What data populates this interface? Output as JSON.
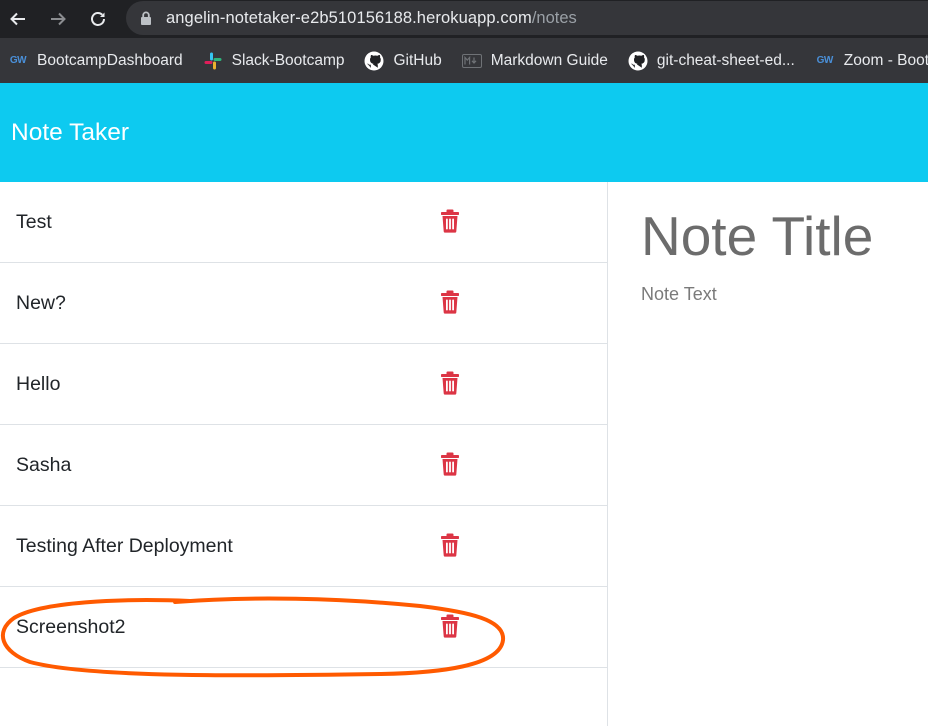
{
  "browser": {
    "url_host": "angelin-notetaker-e2b510156188.herokuapp.com",
    "url_path": "/notes",
    "bookmarks": [
      {
        "label": "BootcampDashboard",
        "icon": "gw-icon"
      },
      {
        "label": "Slack-Bootcamp",
        "icon": "slack-icon"
      },
      {
        "label": "GitHub",
        "icon": "github-icon"
      },
      {
        "label": "Markdown Guide",
        "icon": "markdown-icon"
      },
      {
        "label": "git-cheat-sheet-ed...",
        "icon": "github-icon"
      },
      {
        "label": "Zoom - Bootca",
        "icon": "gw-icon"
      }
    ]
  },
  "app": {
    "title": "Note Taker"
  },
  "notes": [
    {
      "title": "Test"
    },
    {
      "title": "New?"
    },
    {
      "title": "Hello"
    },
    {
      "title": "Sasha"
    },
    {
      "title": "Testing After Deployment"
    },
    {
      "title": "Screenshot2"
    }
  ],
  "editor": {
    "title_placeholder": "Note Title",
    "text_placeholder": "Note Text"
  },
  "colors": {
    "navbar": "#0dcaf0",
    "delete_icon": "#dc3545",
    "annotation": "#ff5a00"
  }
}
